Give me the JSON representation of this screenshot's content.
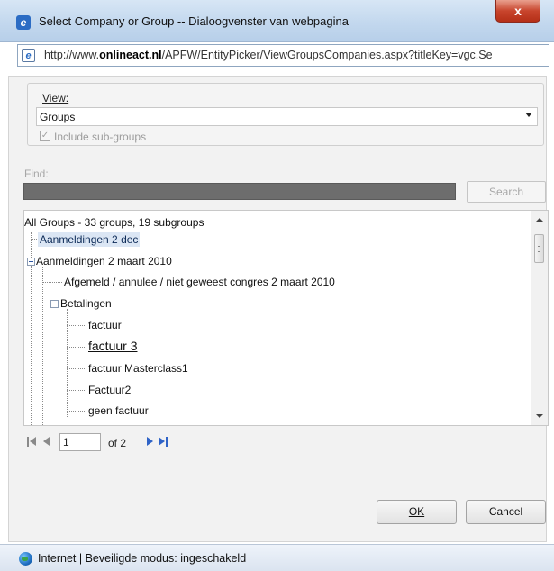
{
  "window": {
    "title": "Select Company or Group -- Dialoogvenster van webpagina",
    "close_label": "x"
  },
  "address": {
    "prefix": "http://www.",
    "domain": "onlineact.nl",
    "path": "/APFW/EntityPicker/ViewGroupsCompanies.aspx?titleKey=vgc.Se"
  },
  "view": {
    "label": "View:",
    "selected": "Groups",
    "include_subgroups_label": "Include sub-groups",
    "include_subgroups_checked": true
  },
  "find": {
    "label": "Find:",
    "value": "",
    "search_button": "Search"
  },
  "tree": {
    "header": "All Groups - 33 groups, 19 subgroups",
    "items": [
      {
        "label": "Aanmeldingen 2 dec",
        "level": 0,
        "selected": true
      },
      {
        "label": "Aanmeldingen 2 maart 2010",
        "level": 0,
        "expanded": true
      },
      {
        "label": "Afgemeld / annulee / niet geweest congres 2 maart 2010",
        "level": 1
      },
      {
        "label": "Betalingen",
        "level": 1,
        "expanded": true
      },
      {
        "label": "factuur",
        "level": 2
      },
      {
        "label": "factuur 3",
        "level": 2,
        "hovered": true
      },
      {
        "label": "factuur Masterclass1",
        "level": 2
      },
      {
        "label": "Factuur2",
        "level": 2
      },
      {
        "label": "geen factuur",
        "level": 2
      }
    ]
  },
  "pager": {
    "current_page": "1",
    "of_text": "of 2"
  },
  "buttons": {
    "ok": "OK",
    "cancel": "Cancel"
  },
  "statusbar": {
    "text": "Internet | Beveiligde modus: ingeschakeld"
  }
}
